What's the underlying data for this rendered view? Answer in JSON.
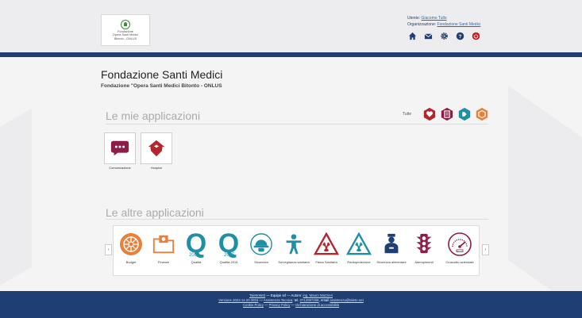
{
  "header": {
    "logo_lines": [
      "Fondazione",
      "Opera Santi Medici",
      "Bitonto - ONLUS"
    ],
    "user_label": "Utente:",
    "user_name": "Giacomo Tullo",
    "org_label": "Organizzazione:",
    "org_name": "Fondazione Santi Medici",
    "icons": [
      "home-icon",
      "mail-icon",
      "gear-icon",
      "help-icon",
      "power-icon"
    ]
  },
  "page": {
    "title": "Fondazione Santi Medici",
    "subtitle": "Fondazione \"Opera Santi Medici Bitonto - ONLUS"
  },
  "my_apps": {
    "title": "Le mie applicazioni",
    "filter_label": "Tutte",
    "filter_colors": [
      "#b3262d",
      "#8e1c48",
      "#1f8fa8",
      "#e8803a"
    ],
    "apps": [
      {
        "label": "Comunicazione",
        "icon": "chat-icon",
        "color": "#8e1c48"
      },
      {
        "label": "Hospice",
        "icon": "hospice-icon",
        "color": "#b3262d"
      }
    ]
  },
  "other_apps": {
    "title": "Le altre applicazioni",
    "items": [
      {
        "label": "Budget",
        "icon": "budget-icon",
        "color": "#e8803a"
      },
      {
        "label": "Finanze",
        "icon": "finance-icon",
        "color": "#e8803a"
      },
      {
        "label": "Qualità",
        "icon": "quality-2008-icon",
        "color": "#1f8fa8",
        "year": "2008"
      },
      {
        "label": "Qualità 2015",
        "icon": "quality-2015-icon",
        "color": "#1f8fa8",
        "year": "2015"
      },
      {
        "label": "Sicurezza",
        "icon": "safety-helmet-icon",
        "color": "#1f8fa8"
      },
      {
        "label": "Sorveglianza sanitaria",
        "icon": "health-surveillance-icon",
        "color": "#1f8fa8"
      },
      {
        "label": "Fisica Sanitaria",
        "icon": "radiation-icon",
        "color": "#b3262d"
      },
      {
        "label": "Radioprotezione",
        "icon": "radioprotection-icon",
        "color": "#1f8fa8"
      },
      {
        "label": "Sicurezza alimentare",
        "icon": "food-safety-icon",
        "color": "#1f3f73"
      },
      {
        "label": "Adempimenti",
        "icon": "traffic-light-icon",
        "color": "#8e1c48"
      },
      {
        "label": "Cruscotto aziendale",
        "icon": "dashboard-gauge-icon",
        "color": "#8e1c48"
      }
    ],
    "prev_arrow": "‹",
    "next_arrow": "›"
  },
  "footer": {
    "l1_brand": "TaleteWeb",
    "l1_mid": " — Equipe srl — Autore: ",
    "l1_author": "ing. Mauro Mazzieri",
    "l2_version": "Versione 2023.12.20.3815",
    "l2_sep": " — ",
    "l2_support": "Assistenza Tecnica",
    "l2_contact": ": tel. ",
    "l2_phone": "0712867258",
    "l2_email_label": ", email ",
    "l2_email": "assistenza@talete.net",
    "l3_cookie": "Cookie Policy",
    "l3_sep1": " — ",
    "l3_privacy": "Privacy Policy",
    "l3_sep2": " — ",
    "l3_access": "Dichiarazione di accessibilità"
  }
}
